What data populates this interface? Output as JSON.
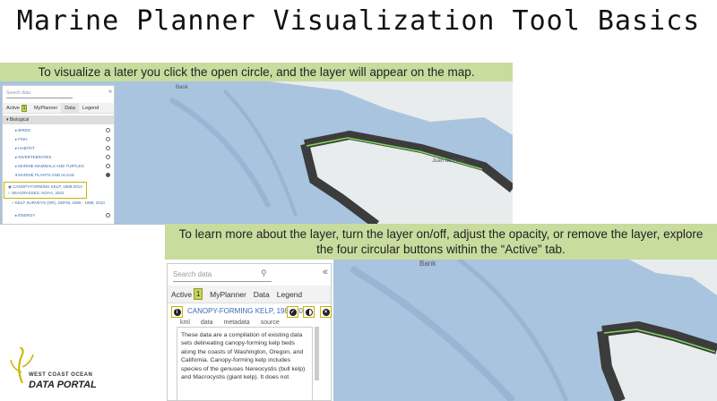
{
  "title": "Marine Planner Visualization Tool Basics",
  "banner_top": "To visualize a later you click the open circle, and the layer will appear on the map.",
  "banner_bottom_line1": "To learn more about the layer, turn the layer on/off, adjust the opacity, or remove the layer, explore",
  "banner_bottom_line2": "the four circular buttons within the “Active” tab.",
  "map": {
    "label_bank": "Bank",
    "label_sound": "Juan de Fuca",
    "colors": {
      "water": "#a9c4de",
      "land": "#e8ecec",
      "kelp": "#3c3c3c",
      "kelp_hi": "#7ed957"
    }
  },
  "panel_small": {
    "search_placeholder": "Search data",
    "tabs": {
      "active": "Active",
      "badge": "1",
      "myplanner": "MyPlanner",
      "data": "Data",
      "legend": "Legend"
    },
    "section": "Biological",
    "rows": [
      "BIRDS",
      "FISH",
      "HABITAT",
      "INVERTEBRATES",
      "MARINE MAMMALS AND TURTLES",
      "MARINE PLANTS AND ALGAE"
    ],
    "highlight_items": [
      "CANOPY-FORMING KELP, 1989-2014",
      "SEAGRASSES, NOAA, 2022"
    ],
    "extra_item": "KELP SURVEYS (OR), ODFW, 1990 - 1999, 2010",
    "energy": "ENERGY"
  },
  "panel_large": {
    "search_placeholder": "Search data",
    "tabs": {
      "active": "Active",
      "badge": "1",
      "myplanner": "MyPlanner",
      "data": "Data",
      "legend": "Legend"
    },
    "layer_name": "CANOPY-FORMING KELP, 1989-2014",
    "subtabs": [
      "kml",
      "data",
      "metadata",
      "source"
    ],
    "description": "These data are a compilation of existing data sets delineating canopy-forming kelp beds along the coasts of Washington, Oregon, and California. Canopy-forming kelp includes species of the genuses Nereocystis (bull kelp) and Macrocystis (giant kelp). It does not"
  },
  "logo": {
    "line1": "WEST COAST OCEAN",
    "line2": "DATA PORTAL"
  }
}
